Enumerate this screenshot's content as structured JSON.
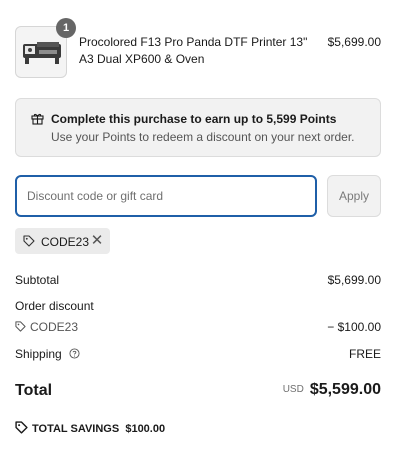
{
  "product": {
    "name": "Procolored F13 Pro Panda DTF Printer 13\" A3 Dual XP600 & Oven",
    "price": "$5,699.00",
    "quantity": "1"
  },
  "points": {
    "title": "Complete this purchase to earn up to 5,599 Points",
    "subtitle": "Use your Points to redeem a discount on your next order."
  },
  "discount": {
    "placeholder": "Discount code or gift card",
    "value": "",
    "apply_label": "Apply",
    "applied_code": "CODE23"
  },
  "summary": {
    "subtotal_label": "Subtotal",
    "subtotal_value": "$5,699.00",
    "order_discount_label": "Order discount",
    "discount_code": "CODE23",
    "discount_value": "− $100.00",
    "shipping_label": "Shipping",
    "shipping_value": "FREE",
    "total_label": "Total",
    "currency": "USD",
    "total_value": "$5,599.00",
    "savings_label": "TOTAL SAVINGS",
    "savings_value": "$100.00"
  },
  "colors": {
    "focus_border": "#1f5fa8",
    "panel_bg": "#f2f2f2",
    "badge_bg": "#666666"
  },
  "icons": [
    "printer-image",
    "gift-icon",
    "tag-icon",
    "close-icon",
    "help-icon",
    "savings-tag-icon"
  ]
}
